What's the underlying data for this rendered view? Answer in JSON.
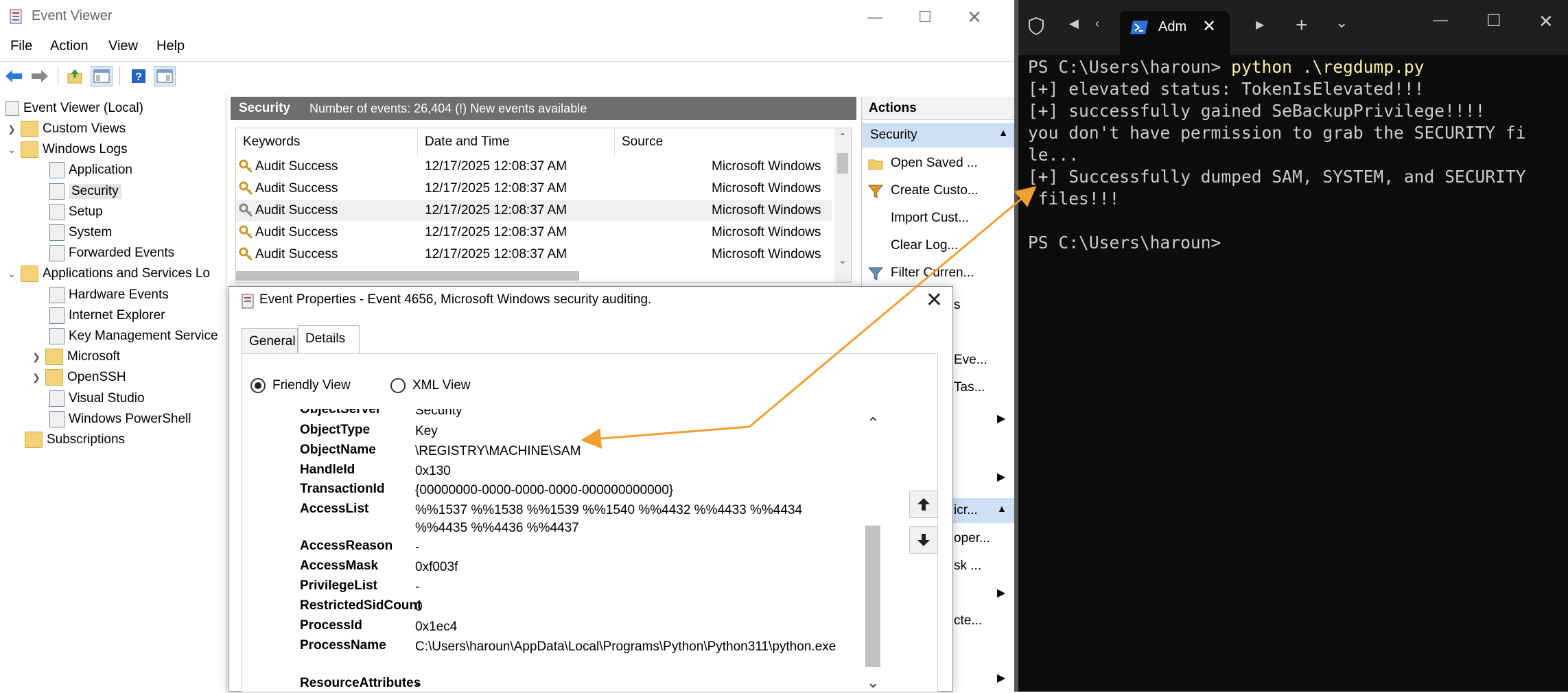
{
  "event_viewer": {
    "title": "Event Viewer",
    "menu": [
      "File",
      "Action",
      "View",
      "Help"
    ],
    "tree": {
      "root": "Event Viewer (Local)",
      "custom_views": "Custom Views",
      "windows_logs": "Windows Logs",
      "application": "Application",
      "security": "Security",
      "setup": "Setup",
      "system": "System",
      "forwarded": "Forwarded Events",
      "app_services": "Applications and Services Lo",
      "hardware": "Hardware Events",
      "ie": "Internet Explorer",
      "kms": "Key Management Service",
      "microsoft": "Microsoft",
      "openssh": "OpenSSH",
      "vs": "Visual Studio",
      "powershell": "Windows PowerShell",
      "subscriptions": "Subscriptions"
    },
    "center": {
      "log_name": "Security",
      "summary": "Number of events: 26,404 (!) New events available",
      "columns": [
        "Keywords",
        "Date and Time",
        "Source"
      ],
      "rows": [
        {
          "keywords": "Audit Success",
          "datetime": "12/17/2025 12:08:37 AM",
          "source": "Microsoft Windows"
        },
        {
          "keywords": "Audit Success",
          "datetime": "12/17/2025 12:08:37 AM",
          "source": "Microsoft Windows"
        },
        {
          "keywords": "Audit Success",
          "datetime": "12/17/2025 12:08:37 AM",
          "source": "Microsoft Windows"
        },
        {
          "keywords": "Audit Success",
          "datetime": "12/17/2025 12:08:37 AM",
          "source": "Microsoft Windows"
        },
        {
          "keywords": "Audit Success",
          "datetime": "12/17/2025 12:08:37 AM",
          "source": "Microsoft Windows"
        }
      ]
    },
    "actions": {
      "header": "Actions",
      "section": "Security",
      "items": [
        "Open Saved ...",
        "Create Custo...",
        "Import Cust...",
        "Clear Log...",
        "Filter Curren..."
      ],
      "partial": [
        "s",
        "Eve...",
        "Tas...",
        "icr...",
        "oper...",
        "sk ...",
        "cte..."
      ]
    }
  },
  "dialog": {
    "title": "Event Properties - Event 4656, Microsoft Windows security auditing.",
    "tabs": [
      "General",
      "Details"
    ],
    "view_options": [
      "Friendly View",
      "XML View"
    ],
    "cut_row": {
      "key": "ObjectServer",
      "value": "Security"
    },
    "fields": [
      {
        "key": "ObjectType",
        "value": "Key"
      },
      {
        "key": "ObjectName",
        "value": "\\REGISTRY\\MACHINE\\SAM"
      },
      {
        "key": "HandleId",
        "value": "0x130"
      },
      {
        "key": "TransactionId",
        "value": "{00000000-0000-0000-0000-000000000000}"
      },
      {
        "key": "AccessList",
        "value": "%%1537 %%1538 %%1539 %%1540 %%4432 %%4433 %%4434 %%4435 %%4436 %%4437"
      },
      {
        "key": "AccessReason",
        "value": "-"
      },
      {
        "key": "AccessMask",
        "value": "0xf003f"
      },
      {
        "key": "PrivilegeList",
        "value": "-"
      },
      {
        "key": "RestrictedSidCount",
        "value": "0"
      },
      {
        "key": "ProcessId",
        "value": "0x1ec4"
      },
      {
        "key": "ProcessName",
        "value": "C:\\Users\\haroun\\AppData\\Local\\Programs\\Python\\Python311\\python.exe"
      },
      {
        "key": "ResourceAttributes",
        "value": "-"
      }
    ]
  },
  "terminal": {
    "tab_title": "Adm",
    "prompt": "PS C:\\Users\\haroun> ",
    "command": "python .\\regdump.py",
    "output": [
      "[+] elevated status: TokenIsElevated!!!",
      "[+] successfully gained SeBackupPrivilege!!!!",
      "you don't have permission to grab the SECURITY fi",
      "le...",
      "[+] Successfully dumped SAM, SYSTEM, and SECURITY",
      " files!!!",
      "",
      "PS C:\\Users\\haroun>"
    ]
  },
  "colors": {
    "arrow": "#f0a030",
    "terminal_bg": "#0c0c0c",
    "selected_action": "#cde0f5"
  }
}
